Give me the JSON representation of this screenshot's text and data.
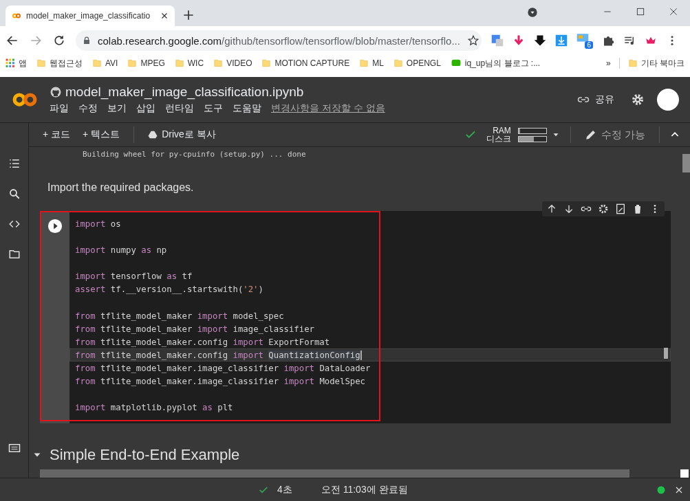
{
  "browser": {
    "tab": {
      "title": "model_maker_image_classificatio"
    },
    "address": {
      "host": "colab.research.google.com",
      "path": "/github/tensorflow/tensorflow/blob/master/tensorflo..."
    },
    "extension_badge": "6",
    "bookmarks": [
      {
        "label": "앱",
        "kind": "apps"
      },
      {
        "label": "웹접근성",
        "kind": "folder"
      },
      {
        "label": "AVI",
        "kind": "folder"
      },
      {
        "label": "MPEG",
        "kind": "folder"
      },
      {
        "label": "WIC",
        "kind": "folder"
      },
      {
        "label": "VIDEO",
        "kind": "folder"
      },
      {
        "label": "MOTION CAPTURE",
        "kind": "folder"
      },
      {
        "label": "ML",
        "kind": "folder"
      },
      {
        "label": "OPENGL",
        "kind": "folder"
      },
      {
        "label": "iq_up님의 블로그 :...",
        "kind": "blog"
      }
    ],
    "bookmarks_overflow": "»",
    "other_bookmarks": "기타 북마크"
  },
  "notebook": {
    "title": "model_maker_image_classification.ipynb",
    "menu": [
      "파일",
      "수정",
      "보기",
      "삽입",
      "런타임",
      "도구",
      "도움말"
    ],
    "save_notice": "변경사항을 저장할 수 없음",
    "share": "공유"
  },
  "toolbar": {
    "add_code": "+ 코드",
    "add_text": "+ 텍스트",
    "copy_to_drive": "Drive로 복사",
    "resources": [
      {
        "label": "RAM",
        "level": 0.06
      },
      {
        "label": "디스크",
        "level": 0.55
      }
    ],
    "edit_mode": "수정 가능"
  },
  "output_line": "Building wheel for py-cpuinfo (setup.py) ... done",
  "text_cell": "Import the required packages.",
  "code_lines": [
    {
      "kind": "code",
      "current": false,
      "tokens": [
        {
          "text": "import",
          "kind": "keyword"
        },
        {
          "text": " os",
          "kind": "plain"
        }
      ]
    },
    {
      "kind": "blank",
      "current": false
    },
    {
      "kind": "code",
      "current": false,
      "tokens": [
        {
          "text": "import",
          "kind": "keyword"
        },
        {
          "text": " numpy ",
          "kind": "plain"
        },
        {
          "text": "as",
          "kind": "keyword"
        },
        {
          "text": " np",
          "kind": "plain"
        }
      ]
    },
    {
      "kind": "blank",
      "current": false
    },
    {
      "kind": "code",
      "current": false,
      "tokens": [
        {
          "text": "import",
          "kind": "keyword"
        },
        {
          "text": " tensorflow ",
          "kind": "plain"
        },
        {
          "text": "as",
          "kind": "keyword"
        },
        {
          "text": " tf",
          "kind": "plain"
        }
      ]
    },
    {
      "kind": "code",
      "current": false,
      "tokens": [
        {
          "text": "assert",
          "kind": "keyword"
        },
        {
          "text": " tf.__version__.startswith(",
          "kind": "plain"
        },
        {
          "text": "'2'",
          "kind": "string"
        },
        {
          "text": ")",
          "kind": "plain"
        }
      ]
    },
    {
      "kind": "blank",
      "current": false
    },
    {
      "kind": "code",
      "current": false,
      "tokens": [
        {
          "text": "from",
          "kind": "keyword"
        },
        {
          "text": " tflite_model_maker ",
          "kind": "plain"
        },
        {
          "text": "import",
          "kind": "keyword"
        },
        {
          "text": " model_spec",
          "kind": "plain"
        }
      ]
    },
    {
      "kind": "code",
      "current": false,
      "tokens": [
        {
          "text": "from",
          "kind": "keyword"
        },
        {
          "text": " tflite_model_maker ",
          "kind": "plain"
        },
        {
          "text": "import",
          "kind": "keyword"
        },
        {
          "text": " image_classifier",
          "kind": "plain"
        }
      ]
    },
    {
      "kind": "code",
      "current": false,
      "tokens": [
        {
          "text": "from",
          "kind": "keyword"
        },
        {
          "text": " tflite_model_maker.config ",
          "kind": "plain"
        },
        {
          "text": "import",
          "kind": "keyword"
        },
        {
          "text": " ExportFormat",
          "kind": "plain"
        }
      ]
    },
    {
      "kind": "code",
      "current": true,
      "tokens": [
        {
          "text": "from",
          "kind": "keyword"
        },
        {
          "text": " tflite_model_maker.config ",
          "kind": "plain"
        },
        {
          "text": "import ",
          "kind": "keyword"
        },
        {
          "text": "QuantizationConfig",
          "kind": "selection"
        }
      ]
    },
    {
      "kind": "code",
      "current": false,
      "tokens": [
        {
          "text": "from",
          "kind": "keyword"
        },
        {
          "text": " tflite_model_maker.image_classifier ",
          "kind": "plain"
        },
        {
          "text": "import",
          "kind": "keyword"
        },
        {
          "text": " DataLoader",
          "kind": "plain"
        }
      ]
    },
    {
      "kind": "code",
      "current": false,
      "tokens": [
        {
          "text": "from",
          "kind": "keyword"
        },
        {
          "text": " tflite_model_maker.image_classifier ",
          "kind": "plain"
        },
        {
          "text": "import",
          "kind": "keyword"
        },
        {
          "text": " ModelSpec",
          "kind": "plain"
        }
      ]
    },
    {
      "kind": "blank",
      "current": false
    },
    {
      "kind": "code",
      "current": false,
      "tokens": [
        {
          "text": "import",
          "kind": "keyword"
        },
        {
          "text": " matplotlib.pyplot ",
          "kind": "plain"
        },
        {
          "text": "as",
          "kind": "keyword"
        },
        {
          "text": " plt",
          "kind": "plain"
        }
      ]
    }
  ],
  "section": {
    "title": "Simple End-to-End Example",
    "expanded": true
  },
  "status": {
    "duration": "4초",
    "completed": "오전 11:03에 완료됨"
  }
}
